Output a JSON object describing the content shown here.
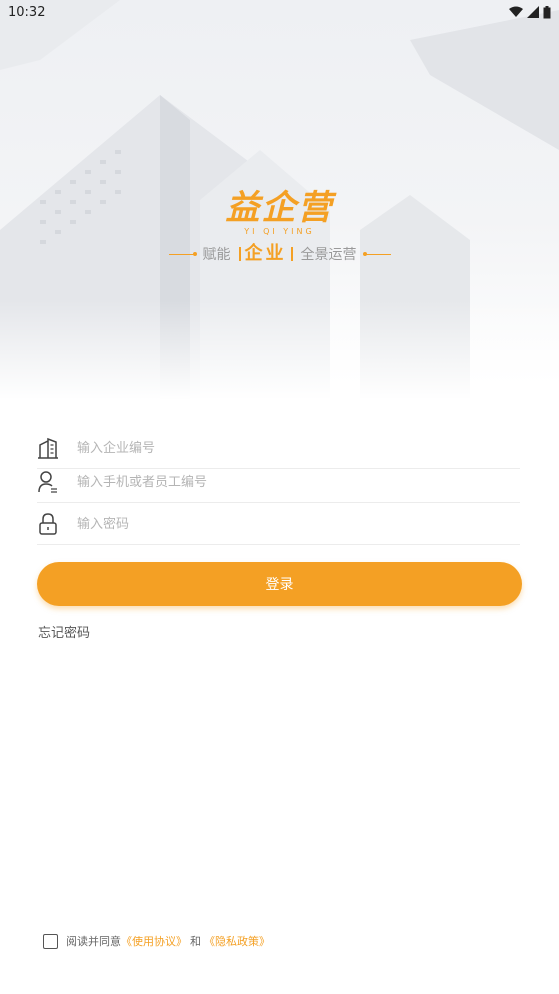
{
  "status_bar": {
    "time": "10:32"
  },
  "brand": {
    "name": "益企营",
    "pinyin": "YI QI YING"
  },
  "slogan": {
    "prefix": "赋能",
    "highlight": "企业",
    "suffix": "全景运营"
  },
  "form": {
    "company_placeholder": "输入企业编号",
    "phone_placeholder": "输入手机或者员工编号",
    "password_placeholder": "输入密码"
  },
  "login_label": "登录",
  "forgot_label": "忘记密码",
  "agreement": {
    "prefix": "阅读并同意",
    "user_agreement": "《使用协议》",
    "and": "和",
    "privacy_policy": "《隐私政策》"
  },
  "colors": {
    "accent": "#f4a024"
  }
}
